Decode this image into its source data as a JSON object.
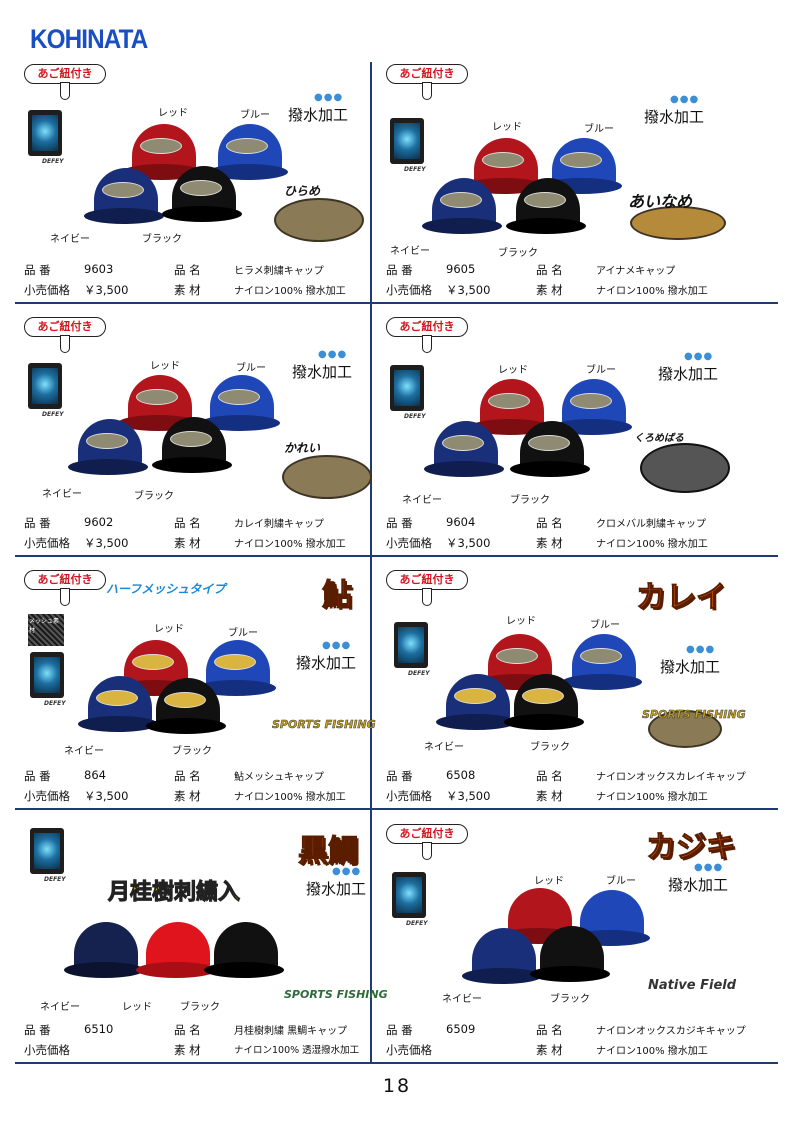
{
  "brand": "KOHINATA",
  "page_number": "18",
  "labels": {
    "hinban": "品 番",
    "hinmei": "品 名",
    "kakaku": "小売価格",
    "sozai": "素 材",
    "tag": "あご紐付き",
    "water": "撥水加工",
    "device": "DEFEY"
  },
  "colors": {
    "red": "レッド",
    "blue": "ブルー",
    "navy": "ネイビー",
    "black": "ブラック"
  },
  "items": [
    {
      "no": "9603",
      "name": "ヒラメ刺繍キャップ",
      "price": "￥3,500",
      "material": "ナイロン100%  撥水加工",
      "art": "ひらめ"
    },
    {
      "no": "9605",
      "name": "アイナメキャップ",
      "price": "￥3,500",
      "material": "ナイロン100%  撥水加工",
      "art": "あいなめ"
    },
    {
      "no": "9602",
      "name": "カレイ刺繍キャップ",
      "price": "￥3,500",
      "material": "ナイロン100%  撥水加工",
      "art": "かれい"
    },
    {
      "no": "9604",
      "name": "クロメバル刺繍キャップ",
      "price": "￥3,500",
      "material": "ナイロン100%  撥水加工",
      "art": "くろめばる"
    },
    {
      "no": "864",
      "name": "鮎メッシュキャップ",
      "price": "￥3,500",
      "material": "ナイロン100%  撥水加工",
      "title": "鮎",
      "mesh": "ハーフメッシュタイプ",
      "swatch": "メッシュ素材",
      "art": "SPORTS FISHING"
    },
    {
      "no": "6508",
      "name": "ナイロンオックスカレイキャップ",
      "price": "￥3,500",
      "material": "ナイロン100%  撥水加工",
      "title": "カレイ",
      "art": "SPORTS FISHING"
    },
    {
      "no": "6510",
      "name": "月桂樹刺繍  黒鯛キャップ",
      "price": "",
      "material": "ナイロン100%  透湿撥水加工",
      "title": "黒鯛",
      "laurel": "月桂樹刺繍入",
      "art": "SPORTS FISHING"
    },
    {
      "no": "6509",
      "name": "ナイロンオックスカジキキャップ",
      "price": "",
      "material": "ナイロン100%  撥水加工",
      "title": "カジキ",
      "art": "Native Field"
    }
  ]
}
